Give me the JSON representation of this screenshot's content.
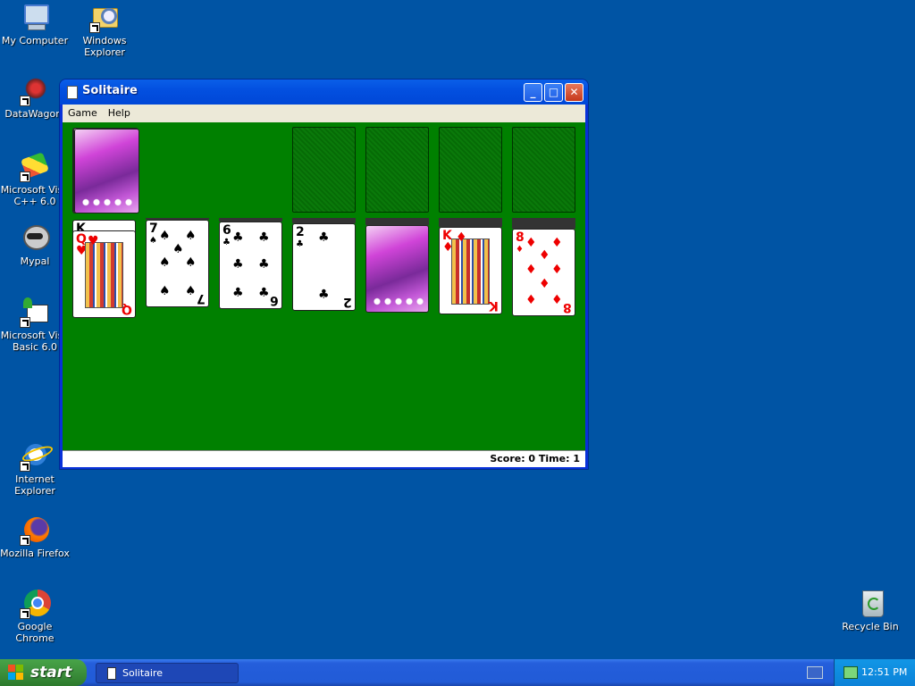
{
  "desktop": {
    "icons": [
      {
        "label": "My Computer"
      },
      {
        "label": "Windows Explorer"
      },
      {
        "label": "DataWagon."
      },
      {
        "label": "Microsoft Visu C++ 6.0"
      },
      {
        "label": "Mypal"
      },
      {
        "label": "Microsoft Visu Basic 6.0"
      },
      {
        "label": "Internet Explorer"
      },
      {
        "label": "Mozilla Firefox"
      },
      {
        "label": "Google Chrome"
      },
      {
        "label": "Recycle Bin"
      }
    ]
  },
  "window": {
    "title": "Solitaire",
    "menu": [
      "Game",
      "Help"
    ],
    "status": "Score: 0 Time: 1",
    "colors": {
      "felt": "#008000"
    }
  },
  "cards": {
    "col1": {
      "rank": "Q",
      "suit": "♥",
      "color": "red",
      "under_rank": "K"
    },
    "col2": {
      "rank": "7",
      "suit": "♠",
      "color": "black"
    },
    "col3": {
      "rank": "6",
      "suit": "♣",
      "color": "black"
    },
    "col4": {
      "rank": "2",
      "suit": "♣",
      "color": "black"
    },
    "col6": {
      "rank": "K",
      "suit": "♦",
      "color": "red"
    },
    "col7": {
      "rank": "8",
      "suit": "♦",
      "color": "red"
    }
  },
  "taskbar": {
    "start_label": "start",
    "task_label": "Solitaire",
    "clock": "12:51 PM"
  }
}
